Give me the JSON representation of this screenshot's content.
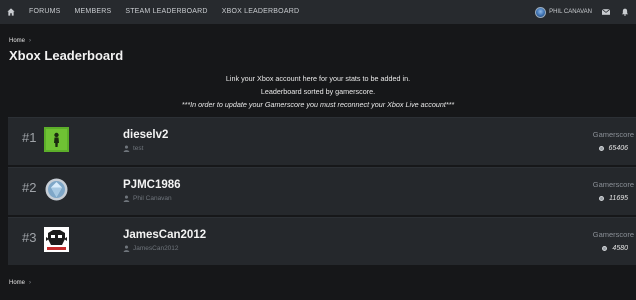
{
  "nav": {
    "items": [
      "FORUMS",
      "MEMBERS",
      "STEAM LEADERBOARD",
      "XBOX LEADERBOARD"
    ],
    "user_name": "PHIL CANAVAN",
    "icons": [
      "home-icon",
      "mail-icon",
      "bell-icon"
    ]
  },
  "breadcrumb": {
    "home": "Home"
  },
  "page": {
    "title": "Xbox Leaderboard"
  },
  "intro": {
    "line1": "Link your Xbox account here for your stats to be added in.",
    "line2": "Leaderboard sorted by gamerscore.",
    "line3": "***In order to update your Gamerscore you must reconnect your Xbox Live account***"
  },
  "leaderboard": {
    "score_label": "Gamerscore",
    "rows": [
      {
        "rank": "#1",
        "gamertag": "dieselv2",
        "member": "test",
        "score": "65406",
        "avatar_color": "#5cae2a"
      },
      {
        "rank": "#2",
        "gamertag": "PJMC1986",
        "member": "Phil Canavan",
        "score": "11695",
        "avatar_color": "#7fa7c8"
      },
      {
        "rank": "#3",
        "gamertag": "JamesCan2012",
        "member": "JamesCan2012",
        "score": "4580",
        "avatar_color": "#ffffff"
      }
    ]
  },
  "footer": {
    "home": "Home"
  }
}
